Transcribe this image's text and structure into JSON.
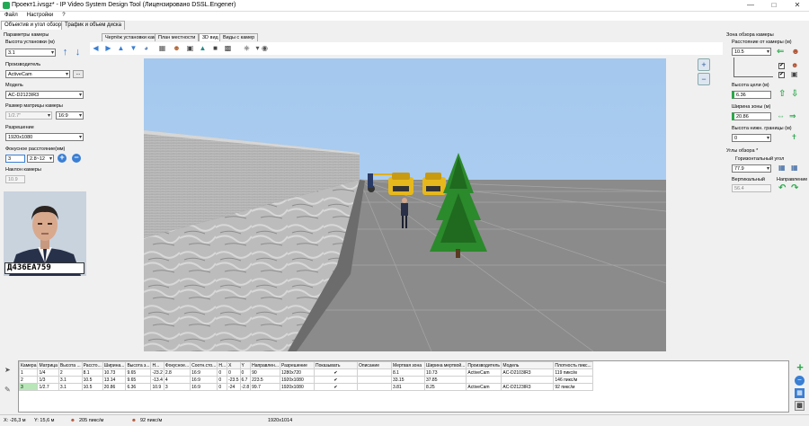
{
  "window": {
    "title": "Проект1.ivsgz* - IP Video System Design Tool (Лицензировано  DSSL.Engener)"
  },
  "menu": [
    "Файл",
    "Настройки",
    "?"
  ],
  "top_tabs": [
    "Объектив и угол обзора",
    "Трафик и объем диска"
  ],
  "left": {
    "camera_params_title": "Параметры камеры",
    "height_label": "Высота установки (м)",
    "height_value": "3.1",
    "manufacturer_label": "Производитель",
    "manufacturer_value": "ActiveCam",
    "more_button": "...",
    "model_label": "Модель",
    "model_value": "AC-D2123IR3",
    "sensor_label": "Размер матрицы камеры",
    "sensor_value": "1/2.7\"",
    "aspect_value": "16:9",
    "resolution_label": "Разрешение",
    "resolution_value": "1920x1080",
    "focal_label": "Фокусное расстояние(мм)",
    "focal_value": "3",
    "focal_range": "2.8~12",
    "tilt_label": "Наклон камеры",
    "tilt_value": "10.9",
    "plate_text": "Д436ЕА759"
  },
  "center_tabs": [
    "Чертёж установки камеры",
    "План местности",
    "3D вид",
    "Виды с камер"
  ],
  "right": {
    "zone_title": "Зона обзора камеры",
    "distance_label": "Расстояние от камеры (м)",
    "distance_value": "10.5",
    "target_height_label": "Высота цели (м)",
    "target_height_value": "6.36",
    "zone_width_label": "Ширина зоны (м)",
    "zone_width_value": "20.86",
    "lower_bound_label": "Высота нижн. границы (м)",
    "lower_bound_value": "0",
    "angles_title": "Углы обзора *",
    "horizontal_label": "Горизонтальный угол",
    "horizontal_value": "77.9",
    "vertical_label": "Вертикальный",
    "vertical_value": "56.4",
    "direction_label": "Направление"
  },
  "table": {
    "columns": [
      "Камера",
      "Матрица",
      "Высота ...",
      "Рассто...",
      "Ширина...",
      "Высота з...",
      "Н...",
      "Фокусное...",
      "Соотн.сто...",
      "Н...",
      "X",
      "Y",
      "Направлен...",
      "Разрешение",
      "Показывать",
      "Описание",
      "Мертвая зона",
      "Ширина мертвой...",
      "Производитель",
      "Модель",
      "Плотность пикс..."
    ],
    "rows": [
      [
        "1",
        "1/4",
        "2",
        "8.1",
        "10.73",
        "9.65",
        "-23.2",
        "2.8",
        "16:9",
        "0",
        "0",
        "0",
        "90",
        "1280x720",
        "✔",
        "",
        "8.1",
        "10.73",
        "ActiveCam",
        "AC-D2103IR3",
        "119 пикс/м"
      ],
      [
        "2",
        "1/3",
        "3.1",
        "10.5",
        "13.14",
        "9.65",
        "-13.4",
        "4",
        "16:9",
        "0",
        "-23.5",
        "6.7",
        "223.5",
        "1920x1080",
        "✔",
        "",
        "33.15",
        "37.85",
        "",
        "",
        "146 пикс/м"
      ],
      [
        "3",
        "1/2.7",
        "3.1",
        "10.5",
        "20.86",
        "6.36",
        "10.9",
        "3",
        "16:9",
        "0",
        "-24",
        "-2.8",
        "99.7",
        "1920x1080",
        "✔",
        "",
        "3.81",
        "8.25",
        "ActiveCam",
        "AC-D2123IR3",
        "92 пикс/м"
      ]
    ]
  },
  "status": {
    "x": "X: -26,3 м",
    "y": "Y: 15,6 м",
    "density1": "205 пикс/м",
    "density2": "92 пикс/м",
    "resolution": "1920x1014"
  },
  "colors": {
    "accent": "#3a7fd4",
    "green": "#2aa84a",
    "sky": "#a8cbef",
    "ground": "#8d8d8d"
  }
}
